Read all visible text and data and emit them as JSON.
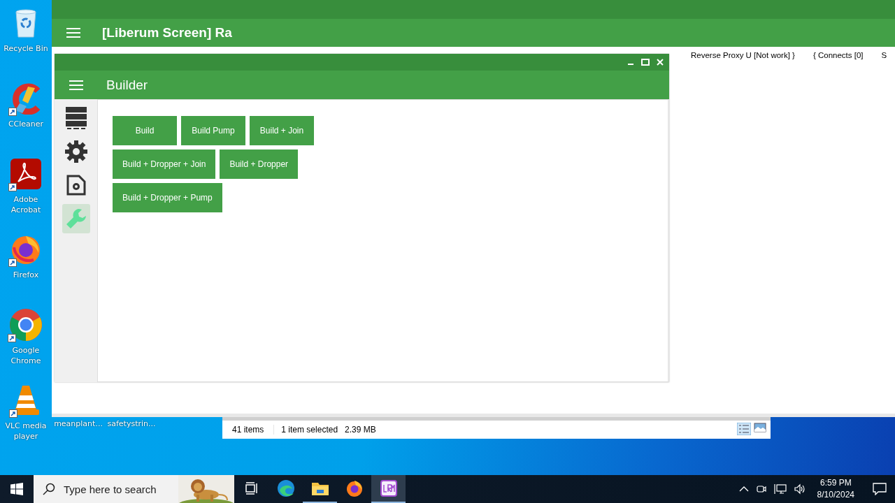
{
  "desktop_icons": [
    {
      "label": "Recycle Bin",
      "kind": "recycle"
    },
    {
      "label": "CCleaner",
      "kind": "ccleaner"
    },
    {
      "label": "Adobe Acrobat",
      "kind": "acrobat"
    },
    {
      "label": "Firefox",
      "kind": "firefox"
    },
    {
      "label": "Google Chrome",
      "kind": "chrome"
    },
    {
      "label": "VLC media player",
      "kind": "vlc"
    }
  ],
  "desktop_files": [
    "meanplant...",
    "safetystrin..."
  ],
  "main_window": {
    "title": "[Liberum Screen] Ra",
    "menu": [
      "Reverse Proxy U [Not work] }",
      "{ Connects [0]",
      "S"
    ]
  },
  "builder": {
    "title": "Builder",
    "sidebar": [
      {
        "kind": "server",
        "selected": false
      },
      {
        "kind": "gear",
        "selected": false
      },
      {
        "kind": "file-gear",
        "selected": false
      },
      {
        "kind": "wrench",
        "selected": true
      }
    ],
    "button_rows": [
      [
        "Build",
        "Build Pump",
        "Build + Join"
      ],
      [
        "Build + Dropper + Join",
        "Build + Dropper"
      ],
      [
        "Build + Dropper + Pump"
      ]
    ]
  },
  "explorer_status": {
    "items": "41 items",
    "selection": "1 item selected",
    "size": "2.39 MB"
  },
  "taskbar": {
    "search_placeholder": "Type here to search",
    "apps": [
      {
        "kind": "taskview",
        "running": false,
        "selected": false
      },
      {
        "kind": "edge",
        "running": false,
        "selected": false
      },
      {
        "kind": "explorer",
        "running": true,
        "selected": false
      },
      {
        "kind": "firefox",
        "running": false,
        "selected": false
      },
      {
        "kind": "lrm",
        "running": true,
        "selected": true
      }
    ],
    "time": "6:59 PM",
    "date": "8/10/2024"
  }
}
